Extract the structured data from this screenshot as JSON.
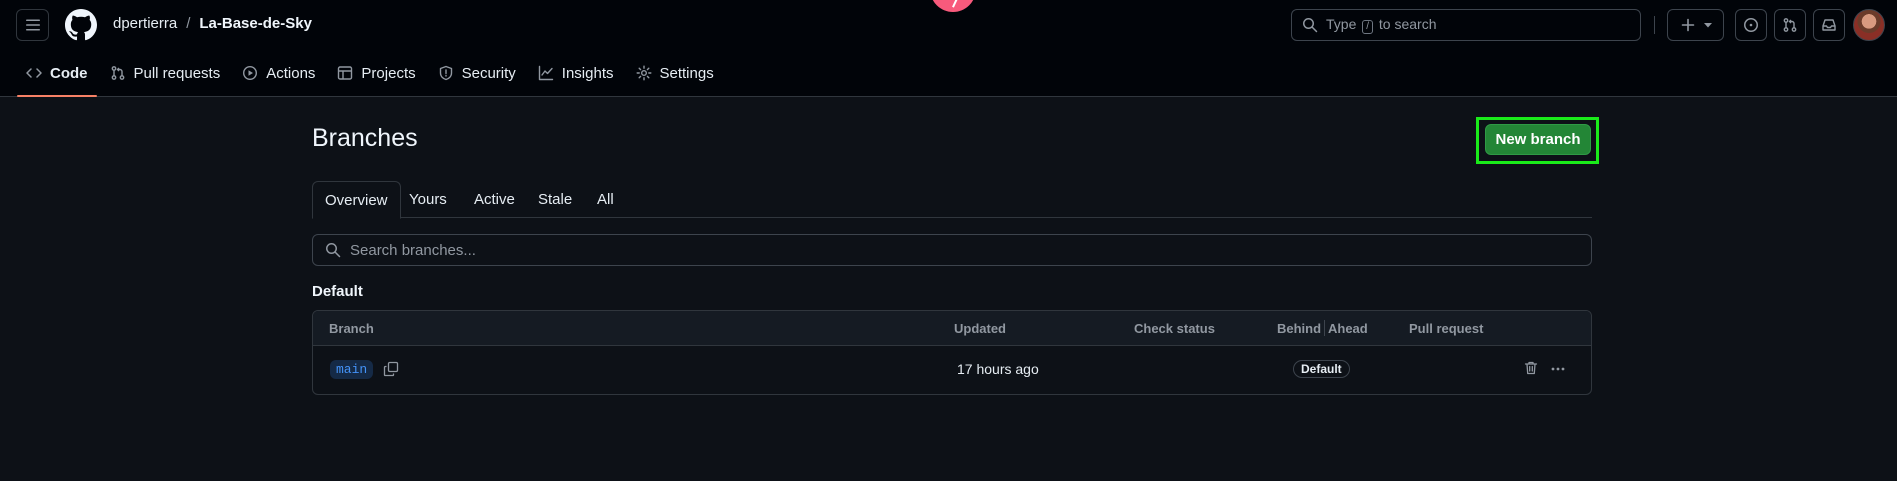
{
  "header": {
    "repo_owner": "dpertierra",
    "repo_separator": "/",
    "repo_name": "La-Base-de-Sky",
    "search": {
      "prefix": "Type",
      "key": "/",
      "suffix": "to search"
    }
  },
  "repo_nav": {
    "items": [
      {
        "label": "Code",
        "icon": "code-icon",
        "selected": true
      },
      {
        "label": "Pull requests",
        "icon": "git-pull-request-icon"
      },
      {
        "label": "Actions",
        "icon": "play-circle-icon"
      },
      {
        "label": "Projects",
        "icon": "table-icon"
      },
      {
        "label": "Security",
        "icon": "shield-icon"
      },
      {
        "label": "Insights",
        "icon": "graph-icon"
      },
      {
        "label": "Settings",
        "icon": "gear-icon"
      }
    ]
  },
  "page": {
    "title": "Branches",
    "new_branch_label": "New branch",
    "tabs": [
      "Overview",
      "Yours",
      "Active",
      "Stale",
      "All"
    ],
    "selected_tab": "Overview",
    "search_placeholder": "Search branches...",
    "section_heading": "Default"
  },
  "branch_table": {
    "columns": {
      "branch": "Branch",
      "updated": "Updated",
      "check_status": "Check status",
      "behind": "Behind",
      "ahead": "Ahead",
      "pull_request": "Pull request"
    },
    "rows": [
      {
        "name": "main",
        "updated": "17 hours ago",
        "badge": "Default"
      }
    ]
  },
  "colors": {
    "background": "#0d1117",
    "header_background": "#010409",
    "accent_underline": "#f78166",
    "primary_button": "#238636",
    "highlight_outline": "#1aeb1a",
    "link_blue": "#4493f8"
  }
}
